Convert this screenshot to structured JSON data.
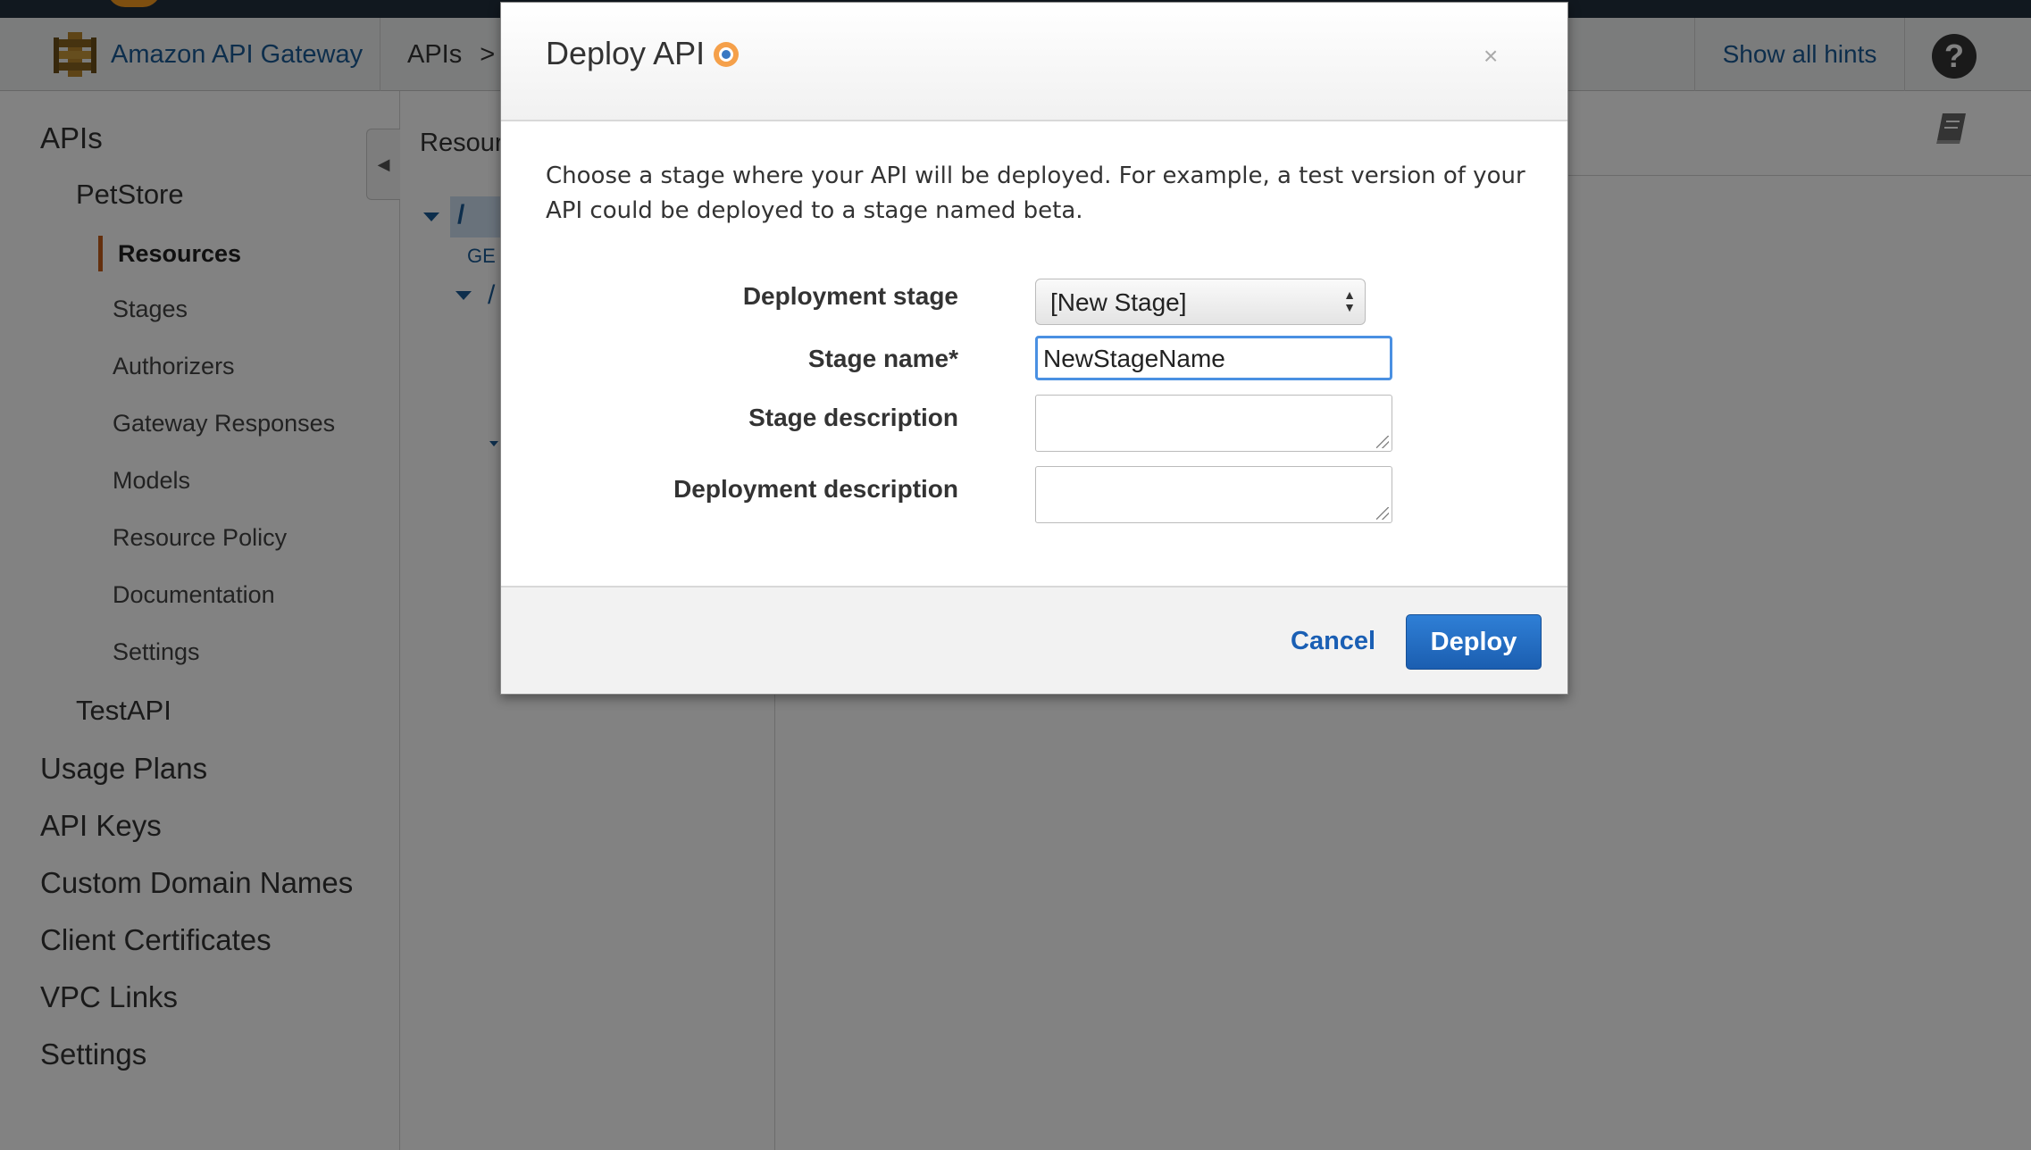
{
  "header": {
    "brand": "Amazon API Gateway",
    "breadcrumb": "APIs",
    "breadcrumb_sep": ">",
    "hints": "Show all hints",
    "help": "?"
  },
  "sidebar": {
    "apis": "APIs",
    "petstore": "PetStore",
    "petstore_items": [
      "Resources",
      "Stages",
      "Authorizers",
      "Gateway Responses",
      "Models",
      "Resource Policy",
      "Documentation",
      "Settings"
    ],
    "testapi": "TestAPI",
    "sections": [
      "Usage Plans",
      "API Keys",
      "Custom Domain Names",
      "Client Certificates",
      "VPC Links",
      "Settings"
    ]
  },
  "resources": {
    "title": "Resour",
    "root": "/",
    "method": "GE",
    "child": "/"
  },
  "modal": {
    "title": "Deploy API",
    "close": "×",
    "intro": "Choose a stage where your API will be deployed. For example, a test version of your API could be deployed to a stage named beta.",
    "fields": {
      "deployment_stage_label": "Deployment stage",
      "deployment_stage_value": "[New Stage]",
      "stage_name_label": "Stage name*",
      "stage_name_value": "NewStageName",
      "stage_description_label": "Stage description",
      "deployment_description_label": "Deployment description"
    },
    "cancel": "Cancel",
    "deploy": "Deploy"
  },
  "colors": {
    "brand_link": "#1a5a96",
    "accent_orange": "#c45c1a",
    "primary_button": "#1b5eb0"
  },
  "icons": [
    "api-gateway-icon",
    "help-icon",
    "collapse-arrow-icon",
    "book-icon",
    "info-icon",
    "close-icon",
    "select-arrows-icon",
    "resize-grip-icon"
  ]
}
